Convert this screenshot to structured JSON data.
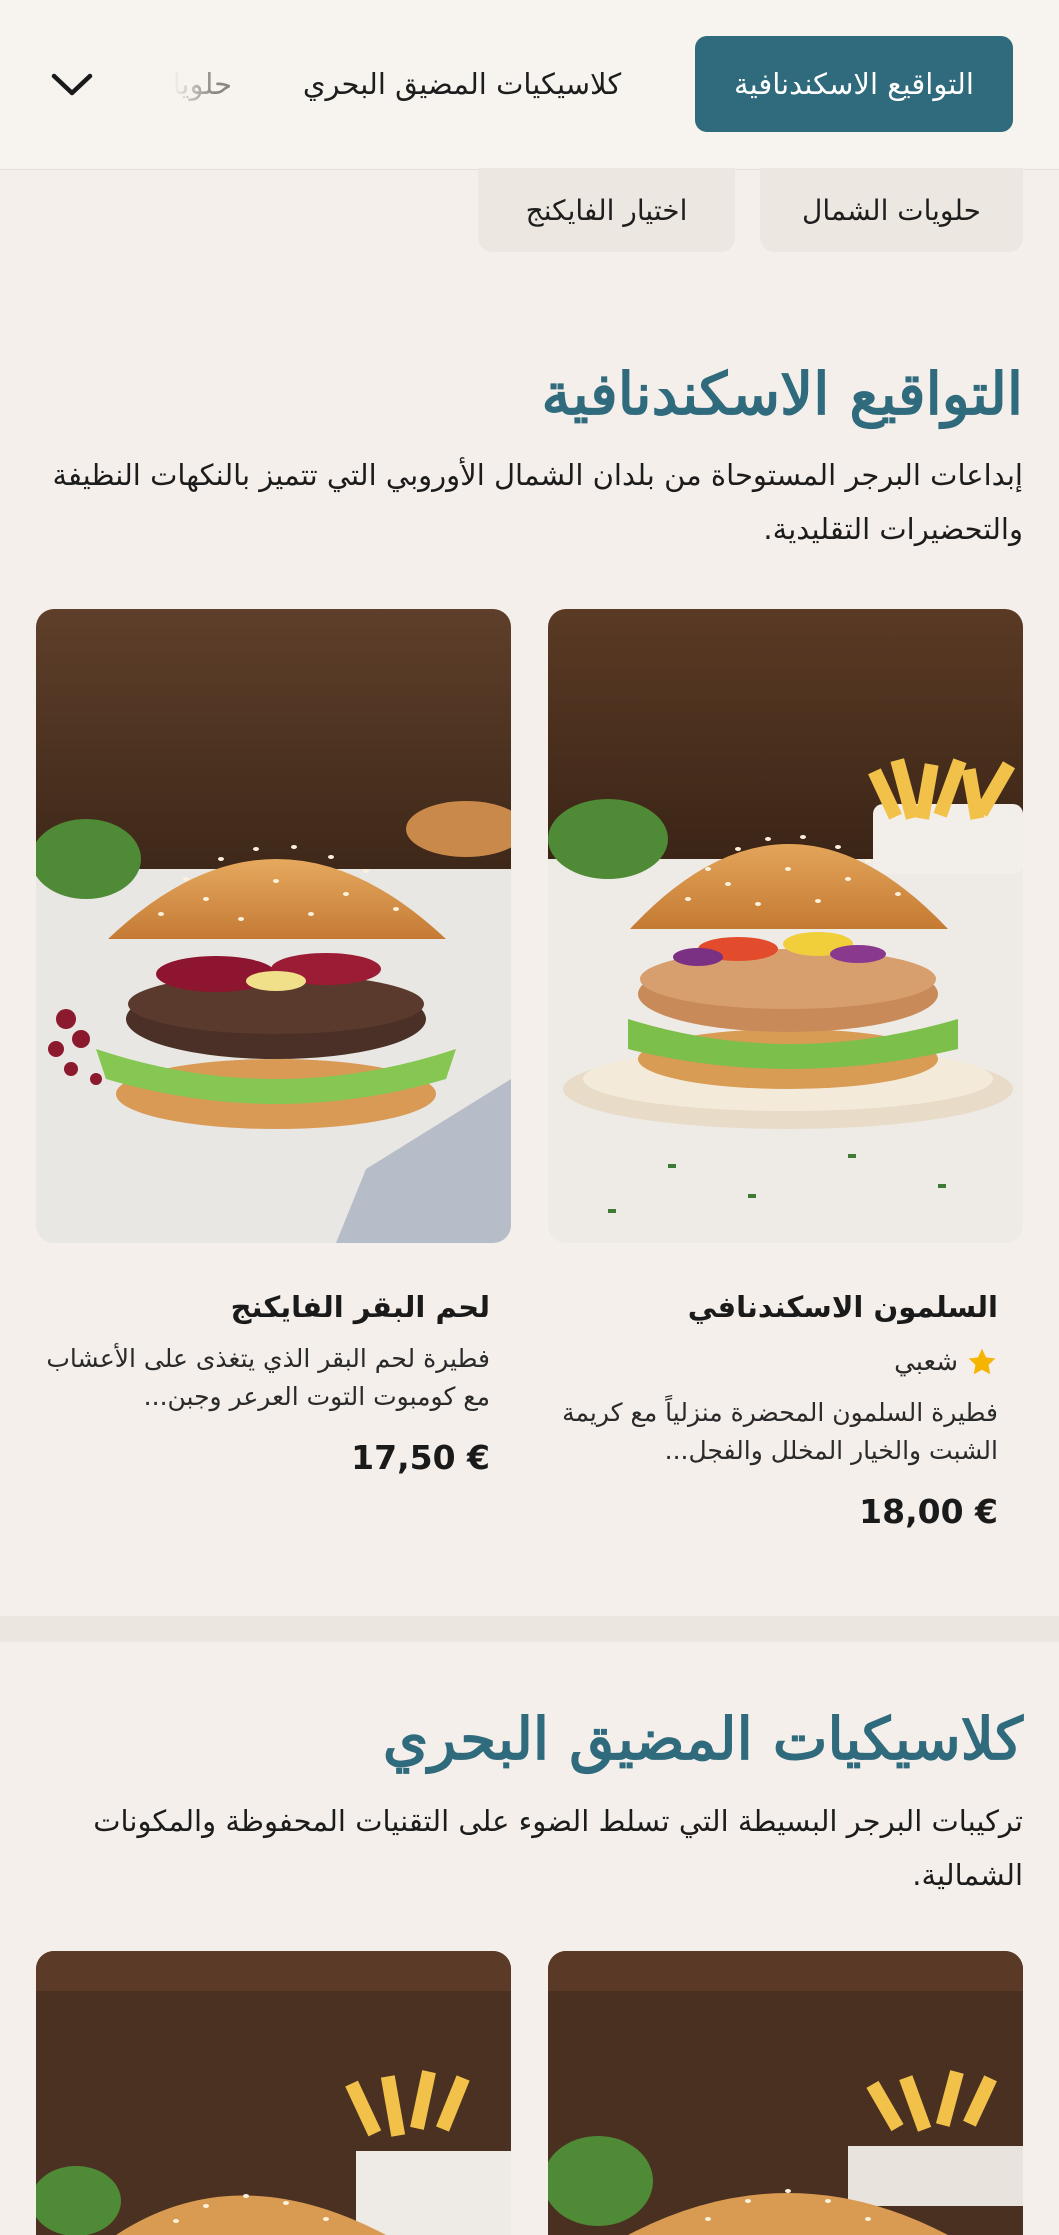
{
  "nav": {
    "tabs": [
      {
        "label": "التواقيع الاسكندنافية",
        "active": true
      },
      {
        "label": "كلاسيكيات المضيق البحري",
        "active": false
      },
      {
        "label": "حلويا",
        "active": false
      }
    ],
    "subtabs": [
      {
        "label": "حلويات الشمال"
      },
      {
        "label": "اختيار الفايكنج"
      }
    ],
    "expand_icon": "chevron-down-icon"
  },
  "sections": [
    {
      "title": "التواقيع الاسكندنافية",
      "description": "إبداعات البرجر المستوحاة من بلدان الشمال الأوروبي التي تتميز بالنكهات النظيفة والتحضيرات التقليدية.",
      "items": [
        {
          "name": "السلمون الاسكندنافي",
          "badge": "شعبي",
          "badge_icon": "star-icon",
          "description": "فطيرة السلمون المحضرة منزلياً مع كريمة الشبت والخيار المخلل والفجل...",
          "price": "18,00 €"
        },
        {
          "name": "لحم البقر الفايكنج",
          "description": "فطيرة لحم البقر الذي يتغذى على الأعشاب مع كومبوت التوت العرعر وجبن...",
          "price": "17,50 €"
        }
      ]
    },
    {
      "title": "كلاسيكيات المضيق البحري",
      "description": "تركيبات البرجر البسيطة التي تسلط الضوء على التقنيات المحفوظة والمكونات الشمالية."
    }
  ],
  "colors": {
    "accent": "#2f6b7c",
    "background": "#f5efeb",
    "star": "#f4b400"
  }
}
